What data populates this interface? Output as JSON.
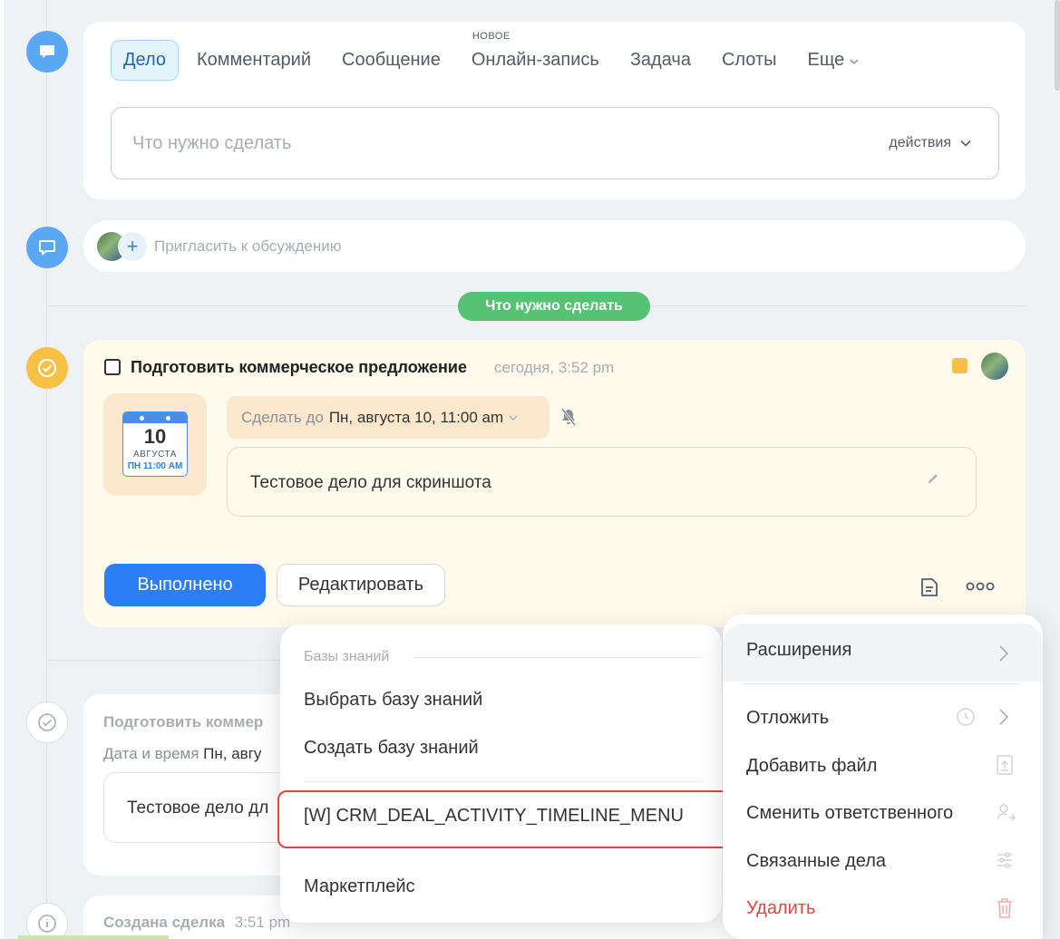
{
  "tabs": {
    "activity": "Дело",
    "comment": "Комментарий",
    "message": "Сообщение",
    "booking": "Онлайн-запись",
    "booking_badge": "НОВОЕ",
    "task": "Задача",
    "slots": "Слоты",
    "more": "Еще"
  },
  "composer": {
    "placeholder": "Что нужно сделать",
    "actions": "действия"
  },
  "invite": {
    "placeholder": "Пригласить к обсуждению"
  },
  "section_badge": "Что нужно сделать",
  "activity": {
    "title": "Подготовить коммерческое предложение",
    "time": "сегодня, 3:52 pm",
    "calendar": {
      "day": "10",
      "month": "АВГУСТА",
      "weekday": "ПН",
      "time": "11:00 AM"
    },
    "deadline_label": "Сделать до",
    "deadline_value": "Пн, августа 10, 11:00 am",
    "description": "Тестовое дело для скриншота",
    "done_button": "Выполнено",
    "edit_button": "Редактировать",
    "colors": {
      "accent": "#2d7ef5",
      "flag": "#f7c046",
      "bg": "#fefaec"
    }
  },
  "past_activity": {
    "title": "Подготовить коммер",
    "date_label": "Дата и время",
    "date_value": "Пн, авгу",
    "description": "Тестовое дело дл"
  },
  "deal_created": {
    "title": "Создана сделка",
    "time": "3:51 pm"
  },
  "submenu": {
    "section": "Базы знаний",
    "choose": "Выбрать базу знаний",
    "create": "Создать базу знаний",
    "placement": "[W] CRM_DEAL_ACTIVITY_TIMELINE_MENU",
    "market": "Маркетплейс",
    "highlight_color": "#e0473f"
  },
  "menu": {
    "extensions": "Расширения",
    "postpone": "Отложить",
    "add_file": "Добавить файл",
    "change_responsible": "Сменить ответственного",
    "related": "Связанные дела",
    "delete": "Удалить",
    "delete_color": "#e0473f"
  }
}
